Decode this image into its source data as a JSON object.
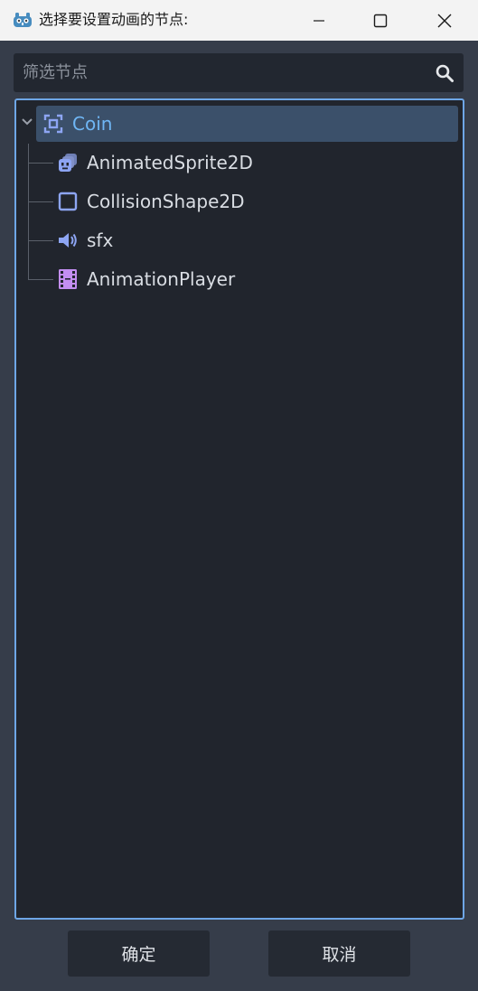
{
  "window": {
    "title": "选择要设置动画的节点:",
    "app_icon": "godot-icon"
  },
  "search": {
    "placeholder": "筛选节点",
    "value": ""
  },
  "tree": {
    "root": {
      "label": "Coin",
      "icon": "node2d-icon",
      "expanded": true,
      "selected": true
    },
    "children": [
      {
        "label": "AnimatedSprite2D",
        "icon": "animated-sprite-icon"
      },
      {
        "label": "CollisionShape2D",
        "icon": "collision-shape-icon"
      },
      {
        "label": "sfx",
        "icon": "audio-icon"
      },
      {
        "label": "AnimationPlayer",
        "icon": "animation-player-icon"
      }
    ]
  },
  "buttons": {
    "ok": "确定",
    "cancel": "取消"
  },
  "colors": {
    "accent": "#6ea6e6",
    "selected_bg": "#3b506a",
    "selected_text": "#6fb6f5",
    "panel_bg": "#21252d",
    "window_bg": "#363d4a"
  }
}
